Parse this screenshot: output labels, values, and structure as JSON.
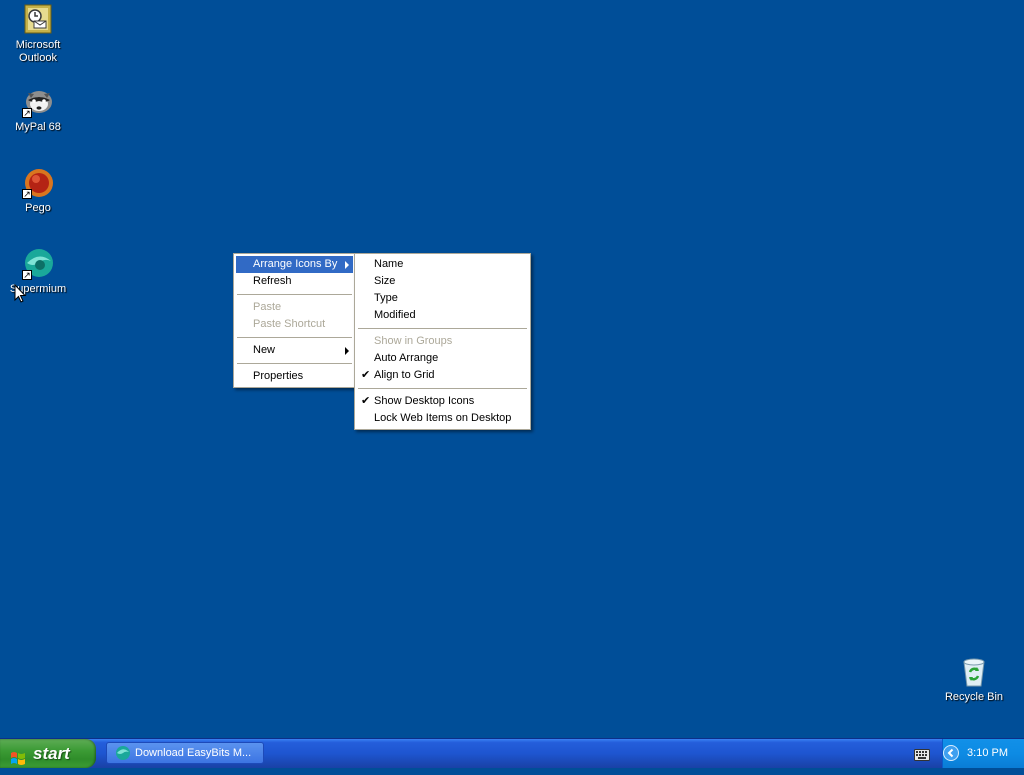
{
  "desktop": {
    "icons": [
      {
        "label": "Microsoft Outlook",
        "icon": "outlook-icon"
      },
      {
        "label": "MyPal 68",
        "icon": "mypal-icon"
      },
      {
        "label": "Pego",
        "icon": "pego-icon"
      },
      {
        "label": "Supermium",
        "icon": "supermium-icon"
      },
      {
        "label": "Recycle Bin",
        "icon": "recycle-bin-icon"
      }
    ]
  },
  "context_menu": {
    "items": [
      {
        "label": "Arrange Icons By",
        "submenu": true,
        "selected": true
      },
      {
        "label": "Refresh"
      },
      {
        "label": "Paste",
        "disabled": true
      },
      {
        "label": "Paste Shortcut",
        "disabled": true
      },
      {
        "label": "New",
        "submenu": true
      },
      {
        "label": "Properties"
      }
    ]
  },
  "submenu": {
    "items": [
      {
        "label": "Name"
      },
      {
        "label": "Size"
      },
      {
        "label": "Type"
      },
      {
        "label": "Modified"
      },
      {
        "label": "Show in Groups",
        "disabled": true
      },
      {
        "label": "Auto Arrange"
      },
      {
        "label": "Align to Grid",
        "checked": true
      },
      {
        "label": "Show Desktop Icons",
        "checked": true
      },
      {
        "label": "Lock Web Items on Desktop"
      }
    ]
  },
  "taskbar": {
    "start_label": "start",
    "task_label": "Download EasyBits M...",
    "clock": "3:10 PM"
  },
  "colors": {
    "desktop": "#004e98",
    "menu_highlight": "#316ac5",
    "start_green": "#3c9b35",
    "taskbar_blue": "#245edb"
  }
}
